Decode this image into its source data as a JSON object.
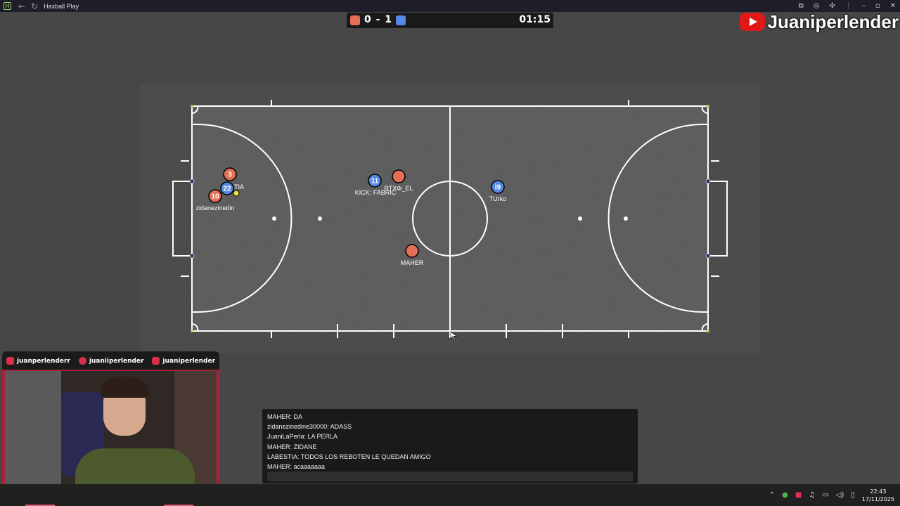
{
  "window": {
    "title": "Haxball Play"
  },
  "scoreboard": {
    "score": "0 - 1",
    "timer": "01:15"
  },
  "channel": {
    "name": "Juaniperlender"
  },
  "players": [
    {
      "team": "red",
      "number": "3",
      "name": ""
    },
    {
      "team": "blue",
      "number": "22",
      "name": "TIA"
    },
    {
      "team": "red",
      "number": "10",
      "name": "zidanezinedin"
    },
    {
      "team": "blue",
      "number": "11",
      "name": "KICK: FABRIC"
    },
    {
      "team": "red",
      "number": "",
      "name": "RTXΦ_EL"
    },
    {
      "team": "blue",
      "number": "I9",
      "name": "TUrko"
    },
    {
      "team": "red",
      "number": "",
      "name": "MAHER"
    }
  ],
  "socials": [
    {
      "icon": "twitter-icon",
      "handle": "juanperlenderr"
    },
    {
      "icon": "instagram-icon",
      "handle": "juaniiperlender"
    },
    {
      "icon": "youtube-icon",
      "handle": "juaniperlender"
    }
  ],
  "chat": {
    "messages": [
      "MAHER: DA",
      "zidanezinedine30000: ADASS",
      "JuaniLaPerla: LA PERLA",
      "MAHER: ZIDANE",
      "LABESTIA: TODOS LOS REBOTEN LE QUEDAN AMIGO",
      "MAHER: acaaaaaaa"
    ]
  },
  "clock": {
    "time": "22:43",
    "date": "17/11/2025"
  },
  "colors": {
    "red_team": "#e56e56",
    "blue_team": "#5689e5",
    "accent": "#a8233a"
  }
}
